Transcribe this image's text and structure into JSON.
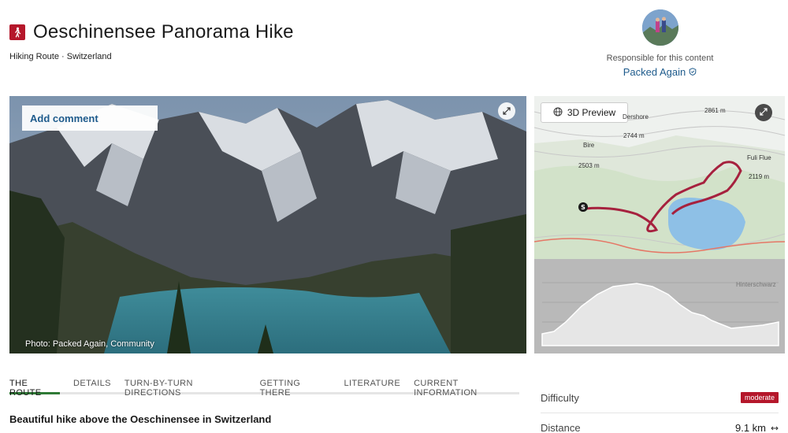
{
  "header": {
    "title": "Oeschinensee Panorama Hike",
    "subtitle": "Hiking Route · Switzerland"
  },
  "author": {
    "responsible_label": "Responsible for this content",
    "name": "Packed Again"
  },
  "photo": {
    "add_comment": "Add comment",
    "caption": "Photo: Packed Again, Community"
  },
  "map": {
    "preview_label": "3D Preview",
    "labels": {
      "peak1": "2861 m",
      "place1": "Dershore",
      "peak2": "2744 m",
      "place2": "Bire",
      "peak3": "2503 m",
      "place3": "Fuli Flue",
      "peak4": "2119 m",
      "profile_place": "Hinterschwarz"
    }
  },
  "tabs": [
    "THE ROUTE",
    "DETAILS",
    "TURN-BY-TURN DIRECTIONS",
    "GETTING THERE",
    "LITERATURE",
    "CURRENT INFORMATION"
  ],
  "section_heading": "Beautiful hike above the Oeschinensee in Switzerland",
  "stats": {
    "difficulty_label": "Difficulty",
    "difficulty_value": "moderate",
    "distance_label": "Distance",
    "distance_value": "9.1 km"
  },
  "colors": {
    "accent_red": "#b5172b",
    "link_blue": "#1e5b8c",
    "tab_active_green": "#2f7a36"
  }
}
